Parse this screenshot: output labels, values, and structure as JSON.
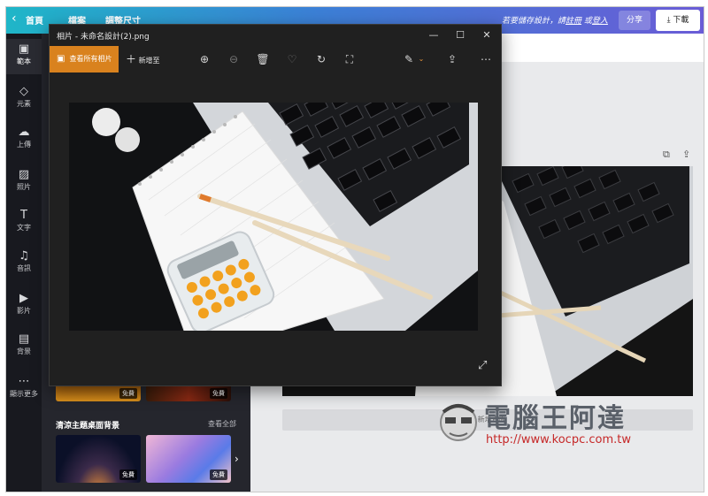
{
  "topbar": {
    "home": "首頁",
    "file": "檔案",
    "resize": "調整尺寸",
    "save_hint_prefix": "若要儲存設計，請",
    "save_hint_register": "註冊",
    "save_hint_or": " 或",
    "save_hint_login": "登入",
    "share": "分享",
    "download": "下載"
  },
  "sidebar": {
    "items": [
      {
        "label": "範本",
        "icon": "template-icon"
      },
      {
        "label": "元素",
        "icon": "elements-icon"
      },
      {
        "label": "上傳",
        "icon": "upload-icon"
      },
      {
        "label": "照片",
        "icon": "photo-icon"
      },
      {
        "label": "文字",
        "icon": "text-icon"
      },
      {
        "label": "音訊",
        "icon": "music-icon"
      },
      {
        "label": "影片",
        "icon": "video-icon"
      },
      {
        "label": "背景",
        "icon": "background-icon"
      },
      {
        "label": "顯示更多",
        "icon": "more-icon"
      }
    ]
  },
  "panel": {
    "free_badge": "免費",
    "section_title": "清涼主題桌面背景",
    "see_all": "查看全部"
  },
  "canvas": {
    "add_page": "+ 新增頁面"
  },
  "viewer": {
    "title": "相片 - 未命名設計(2).png",
    "view_all": "查看所有相片",
    "add_to": "新增至",
    "minimize": "—",
    "maximize": "☐",
    "close": "✕"
  },
  "watermark": {
    "title": "電腦王阿達",
    "url": "http://www.kocpc.com.tw"
  },
  "colors": {
    "accent_orange": "#d9821e",
    "topbar_start": "#1fb6c8",
    "topbar_end": "#6a5cd6"
  }
}
